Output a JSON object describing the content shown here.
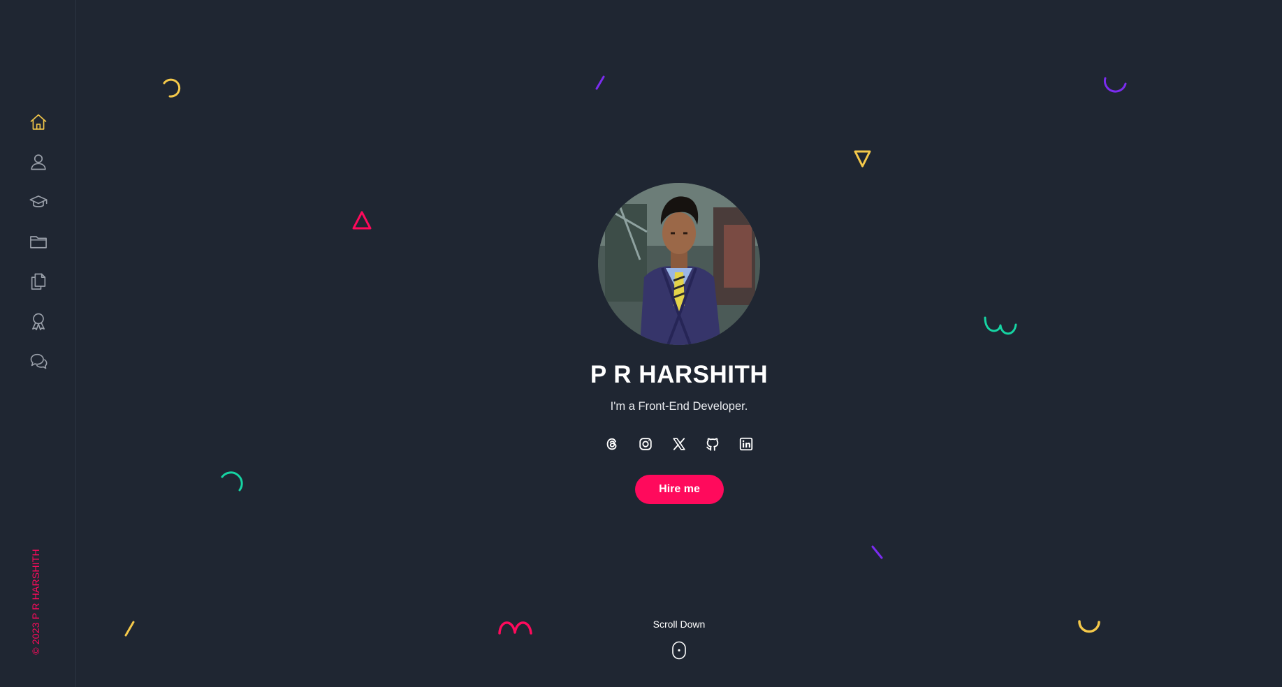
{
  "sidebar": {
    "items": [
      {
        "name": "home",
        "icon": "home-icon",
        "active": true
      },
      {
        "name": "about",
        "icon": "user-icon",
        "active": false
      },
      {
        "name": "education",
        "icon": "graduation-cap-icon",
        "active": false
      },
      {
        "name": "projects",
        "icon": "folder-icon",
        "active": false
      },
      {
        "name": "documents",
        "icon": "files-icon",
        "active": false
      },
      {
        "name": "achievements",
        "icon": "award-icon",
        "active": false
      },
      {
        "name": "contact",
        "icon": "chat-icon",
        "active": false
      }
    ],
    "copyright": "© 2023 P R HARSHITH"
  },
  "hero": {
    "name": "P R HARSHITH",
    "tagline": "I'm a Front-End Developer.",
    "socials": [
      {
        "icon": "threads-icon"
      },
      {
        "icon": "instagram-icon"
      },
      {
        "icon": "x-twitter-icon"
      },
      {
        "icon": "github-icon"
      },
      {
        "icon": "linkedin-icon"
      }
    ],
    "cta_label": "Hire me",
    "scroll_label": "Scroll Down"
  },
  "colors": {
    "background": "#1f2632",
    "accent": "#ff0a5c",
    "active_icon": "#f5c94a",
    "inactive_icon": "#9aa0aa",
    "deco_yellow": "#f5c94a",
    "deco_purple": "#7b2cf0",
    "deco_teal": "#16d4a3",
    "deco_pink": "#ff0a5c"
  }
}
